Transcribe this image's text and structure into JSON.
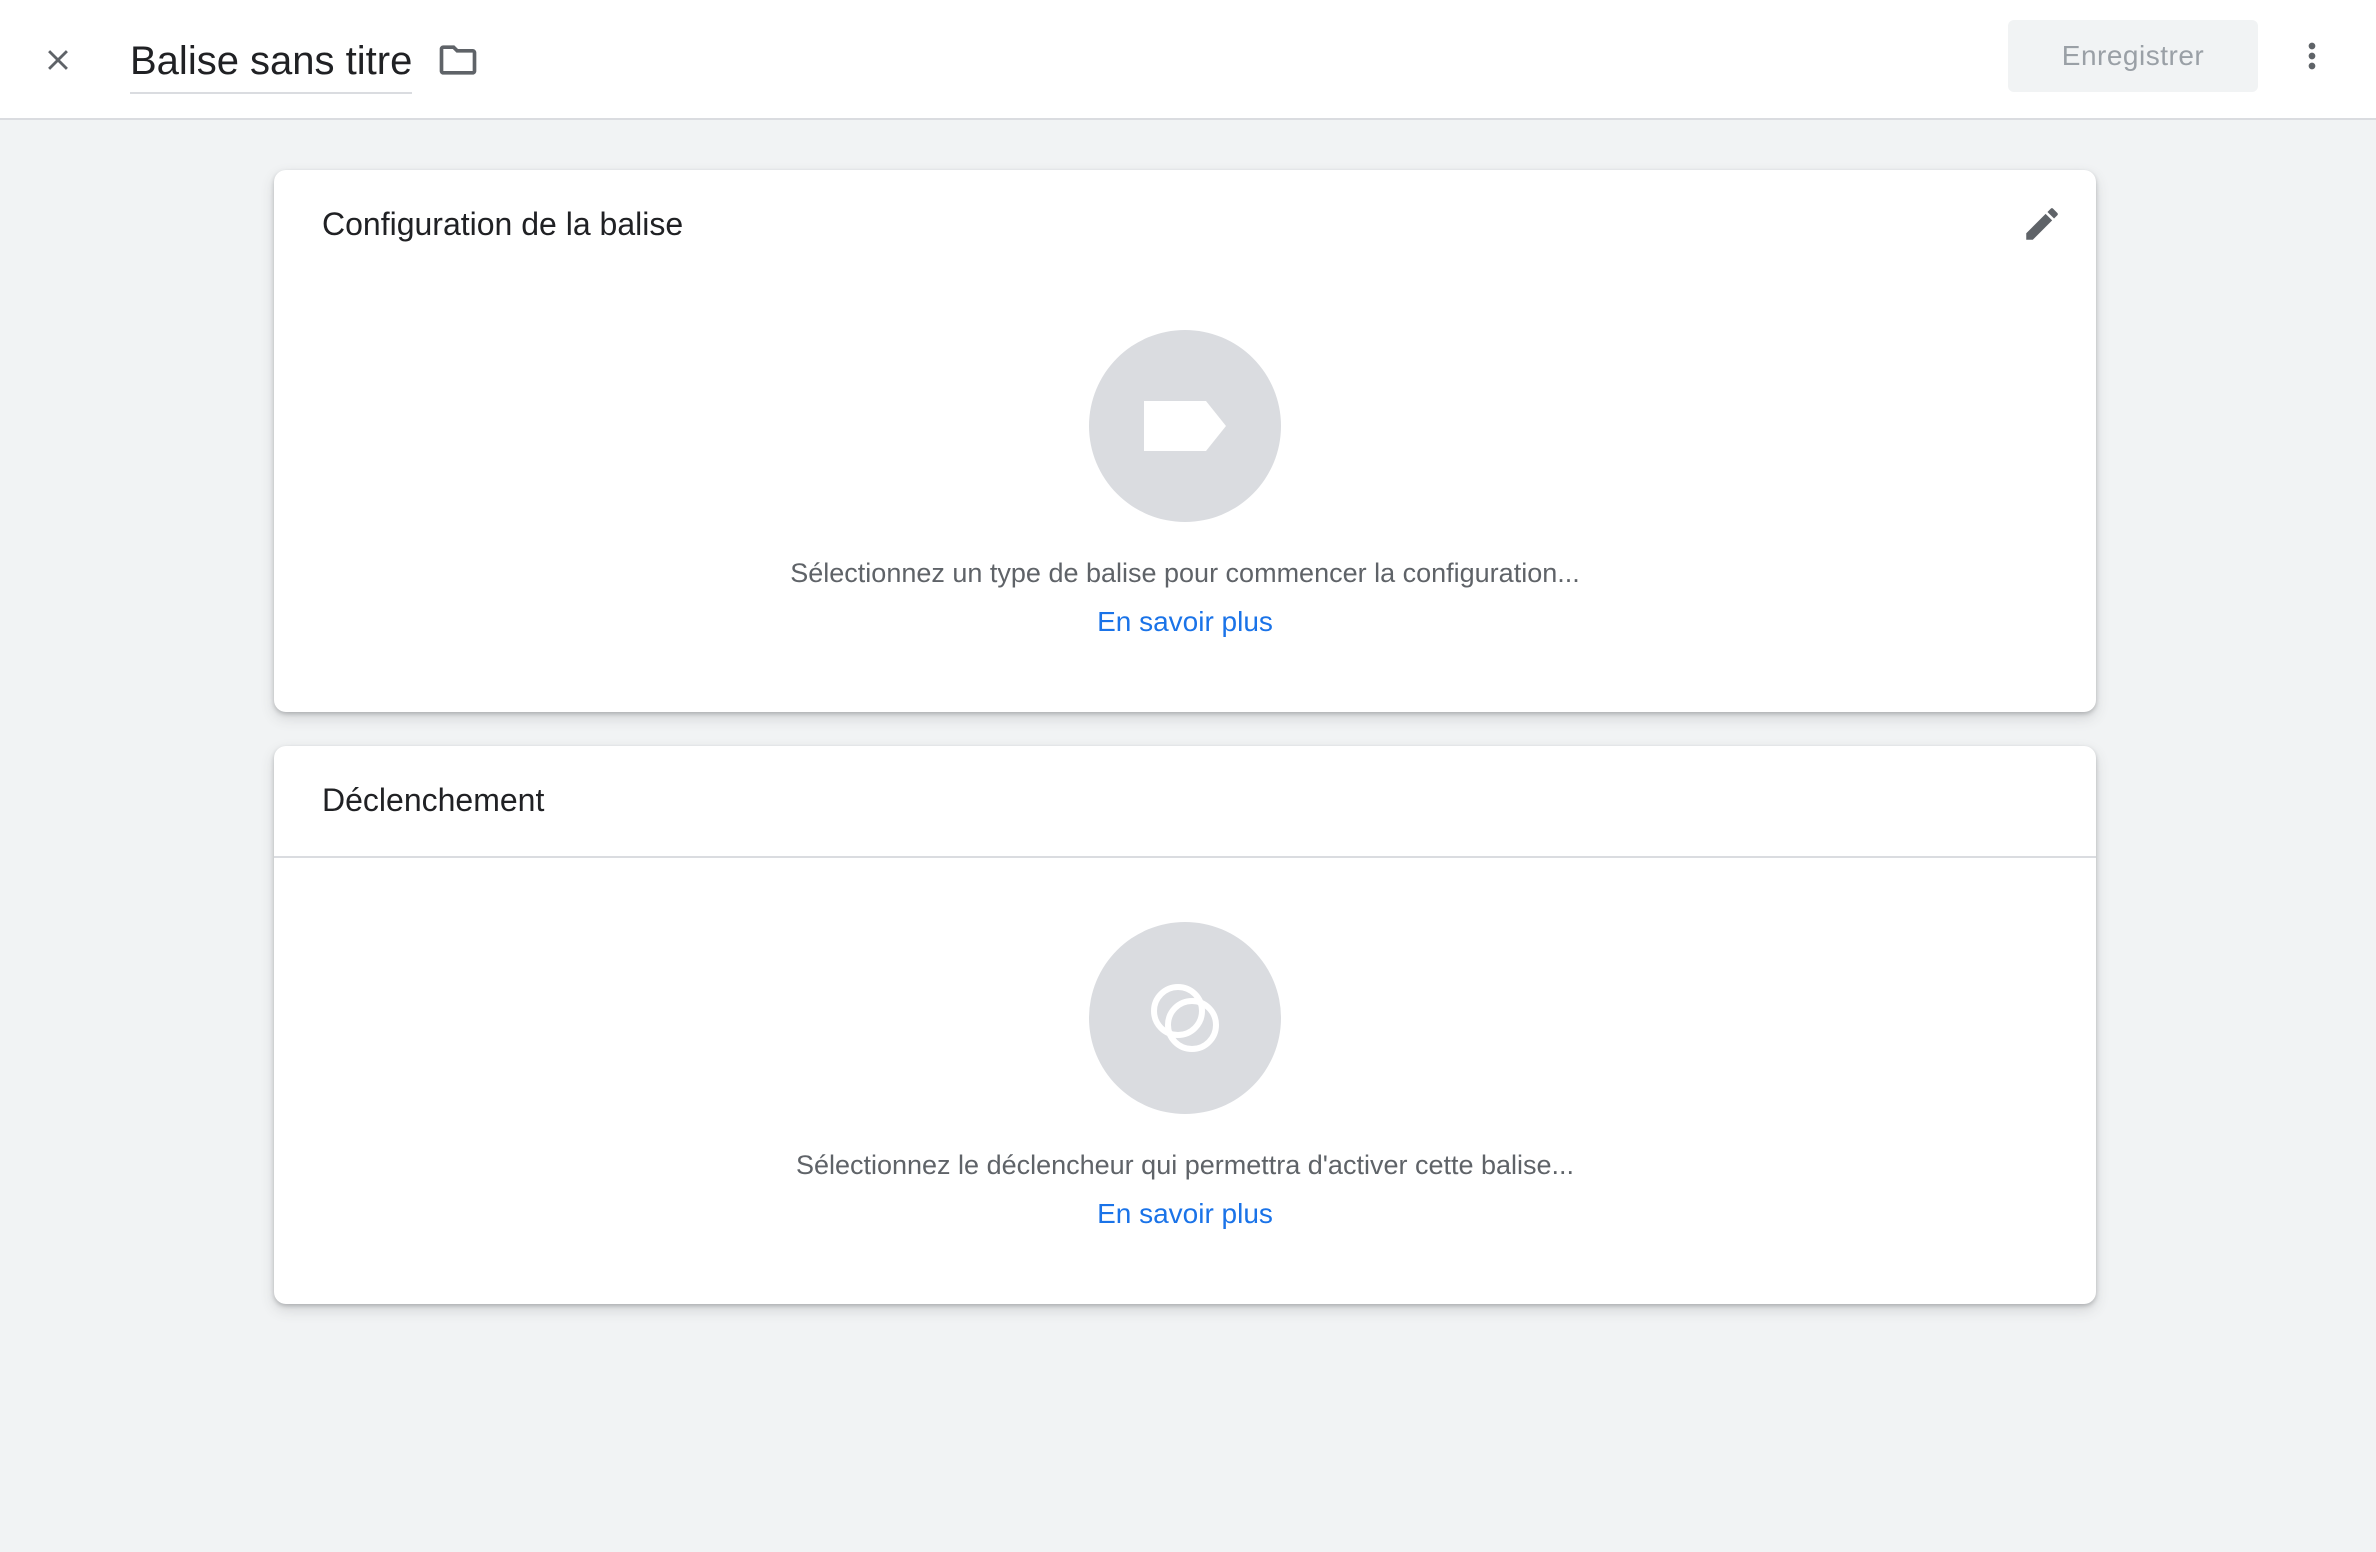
{
  "header": {
    "title": "Balise sans titre",
    "save_label": "Enregistrer",
    "icons": {
      "close": "close-icon",
      "folder": "folder-icon",
      "more": "more-vert-icon"
    }
  },
  "config_card": {
    "title": "Configuration de la balise",
    "hint": "Sélectionnez un type de balise pour commencer la configuration...",
    "link": "En savoir plus",
    "icons": {
      "edit": "pencil-icon",
      "placeholder": "tag-icon"
    }
  },
  "trigger_card": {
    "title": "Déclenchement",
    "hint": "Sélectionnez le déclencheur qui permettra d'activer cette balise...",
    "link": "En savoir plus",
    "icons": {
      "placeholder": "trigger-icon"
    }
  },
  "colors": {
    "background": "#f1f3f4",
    "card": "#ffffff",
    "link": "#1a73e8",
    "placeholder_circle": "#dadce0",
    "disabled_text": "#9aa0a6"
  }
}
